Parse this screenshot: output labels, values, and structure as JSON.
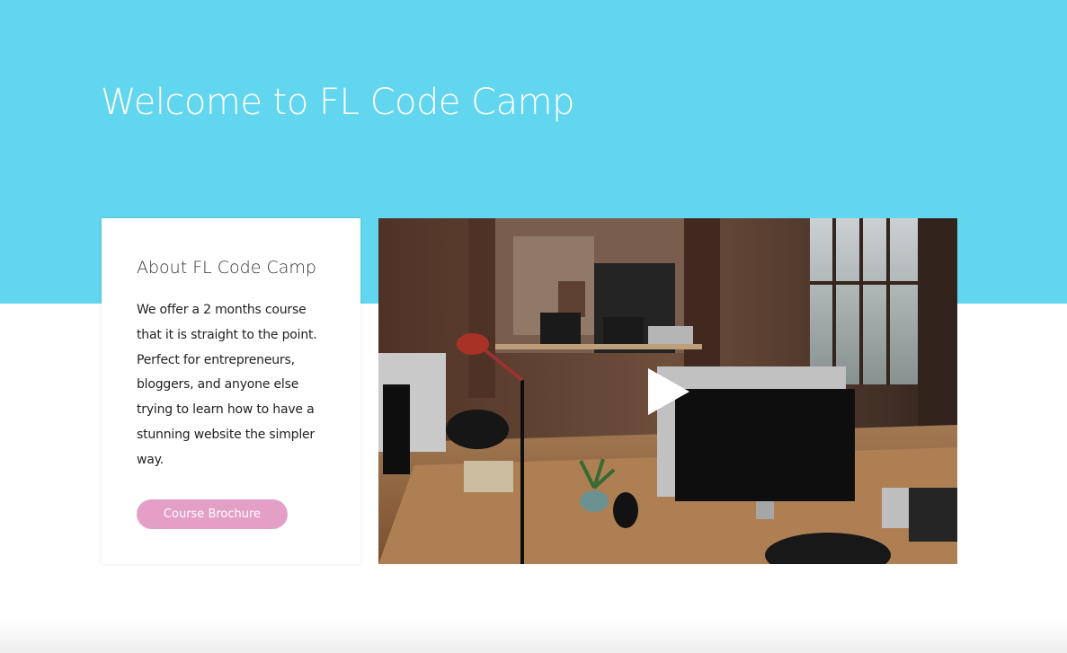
{
  "hero": {
    "title": "Welcome to FL Code Camp",
    "background_color": "#62d6ee"
  },
  "about": {
    "title": "About FL Code Camp",
    "text": "We offer a 2 months course\nthat it is straight to the point.\nPerfect for entrepreneurs,\nbloggers, and  anyone else\ntrying to learn how to have a\nstunning  website the simpler\nway.",
    "button_label": "Course Brochure",
    "button_color": "#e39fc6"
  },
  "video": {
    "play_icon": "play-icon",
    "thumbnail_icon": "office-photo"
  }
}
